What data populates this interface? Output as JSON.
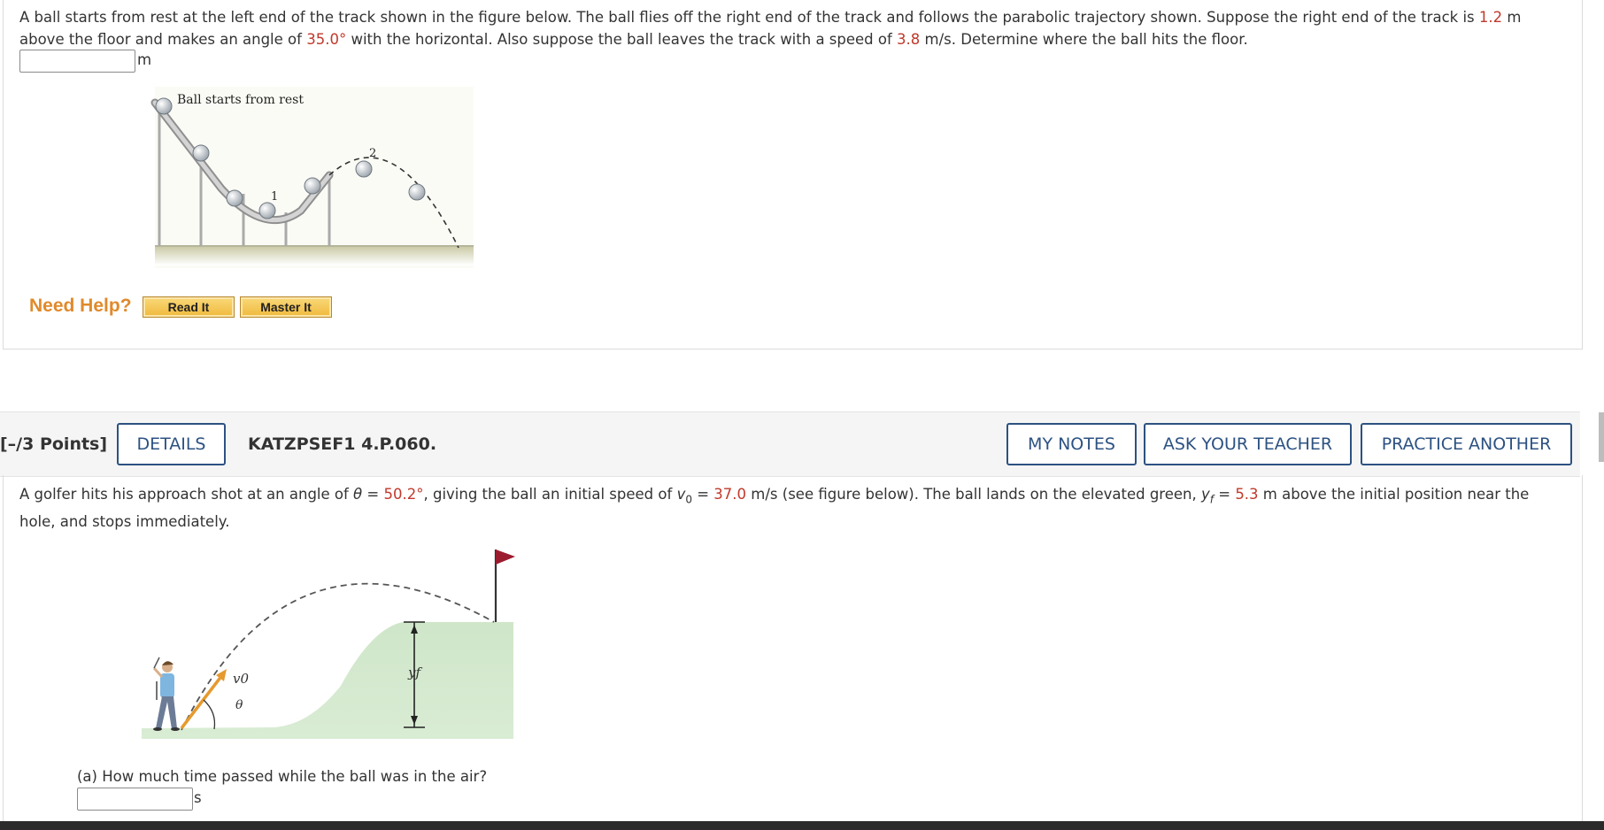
{
  "problem1": {
    "text_a": "A ball starts from rest at the left end of the track shown in the figure below. The ball flies off the right end of the track and follows the parabolic trajectory shown. Suppose the right end of the track is ",
    "height": "1.2",
    "text_b": " m above the floor and makes an angle of ",
    "angle": "35.0°",
    "text_c": " with the horizontal. Also suppose the ball leaves the track with a speed of ",
    "speed": "3.8",
    "text_d": " m/s. Determine where the ball hits the floor.",
    "answer_value": "",
    "answer_unit": "m",
    "figure": {
      "label_start": "Ball starts from rest",
      "label_1": "1",
      "label_2": "2"
    }
  },
  "help": {
    "label": "Need Help?",
    "read_it": "Read It",
    "master_it": "Master It"
  },
  "question_header": {
    "points": "[–/3 Points]",
    "details": "DETAILS",
    "id": "KATZPSEF1 4.P.060.",
    "my_notes": "MY NOTES",
    "ask_teacher": "ASK YOUR TEACHER",
    "practice_another": "PRACTICE ANOTHER"
  },
  "problem2": {
    "text_a": "A golfer hits his approach shot at an angle of ",
    "theta_sym": "θ",
    "eq1": " = ",
    "theta": "50.2°",
    "text_b": ", giving the ball an initial speed of ",
    "v0_sym": "v",
    "v0_sub": "0",
    "eq2": " = ",
    "v0": "37.0",
    "text_c": " m/s (see figure below). The ball lands on the elevated green, ",
    "yf_sym": "y",
    "yf_sub": "f",
    "eq3": " = ",
    "yf": "5.3",
    "text_d": " m above the initial position near the hole, and stops immediately.",
    "figure": {
      "label_v0": "v0",
      "label_theta": "θ",
      "label_yf": "yf"
    },
    "part_a": {
      "question": "(a) How much time passed while the ball was in the air?",
      "answer_value": "",
      "unit": "s"
    }
  },
  "colors": {
    "given_value": "#c0392b",
    "button_outline": "#2c5282",
    "need_help": "#e08a2b",
    "green_hill": "#cfe6c9"
  }
}
